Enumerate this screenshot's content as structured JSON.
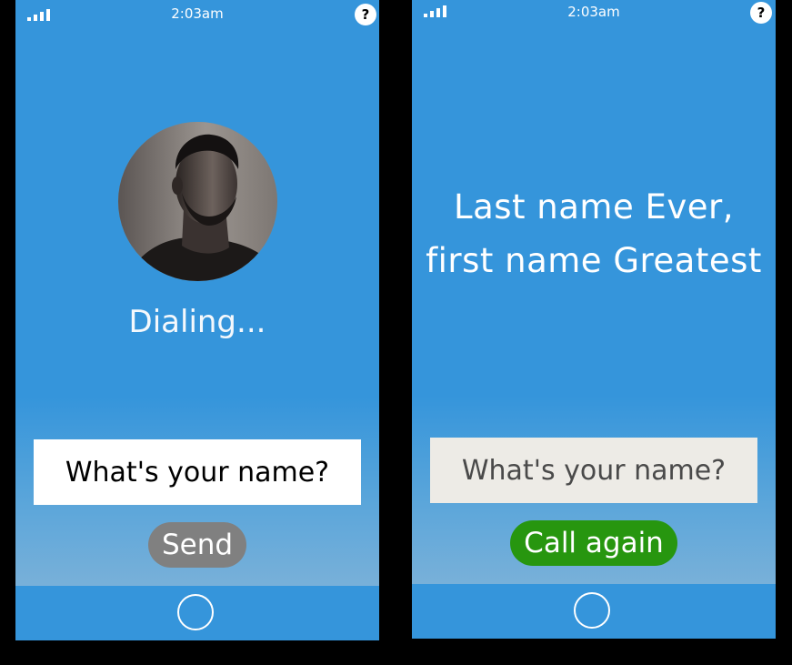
{
  "screens": {
    "left": {
      "status_bar": {
        "time": "2:03am",
        "help_label": "?"
      },
      "avatar": {
        "icon": "person-portrait"
      },
      "status_text": "Dialing...",
      "input": {
        "placeholder": "What's your name?",
        "value": ""
      },
      "send_label": "Send"
    },
    "right": {
      "status_bar": {
        "time": "2:03am",
        "help_label": "?"
      },
      "result_lines": [
        "Last name Ever,",
        "first name Greatest"
      ],
      "input": {
        "placeholder": "What's your name?",
        "value": ""
      },
      "call_again_label": "Call again"
    }
  },
  "colors": {
    "screen_background": "#3595db",
    "send_button": "#808080",
    "call_again_button": "#27960f"
  }
}
